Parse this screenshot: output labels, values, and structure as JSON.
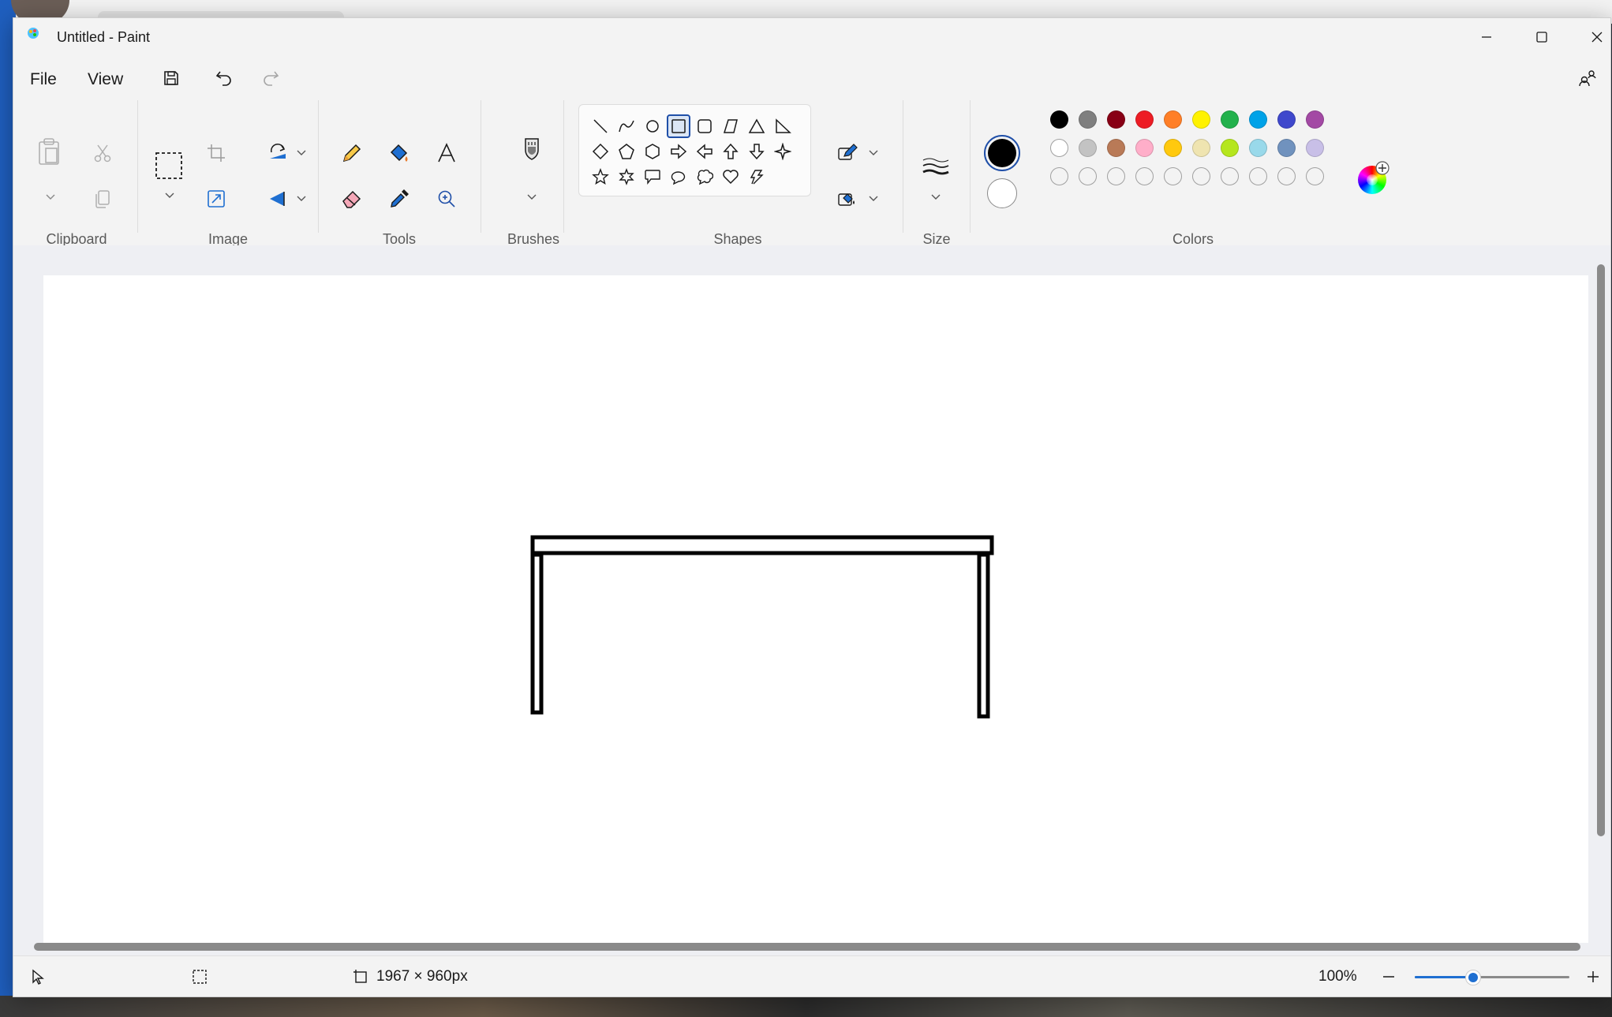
{
  "window": {
    "title": "Untitled - Paint"
  },
  "menu": {
    "file": "File",
    "view": "View"
  },
  "ribbon": {
    "groups": {
      "clipboard": "Clipboard",
      "image": "Image",
      "tools": "Tools",
      "brushes": "Brushes",
      "shapes": "Shapes",
      "size": "Size",
      "colors": "Colors"
    }
  },
  "colors": {
    "primary": "#000000",
    "secondary": "#ffffff",
    "palette_row1": [
      "#000000",
      "#7f7f7f",
      "#880015",
      "#ed1c24",
      "#ff7f27",
      "#fff200",
      "#22b14c",
      "#00a2e8",
      "#3f48cc",
      "#a349a4"
    ],
    "palette_row2": [
      "#ffffff",
      "#c3c3c3",
      "#b97a57",
      "#ffaec9",
      "#ffc90e",
      "#efe4b0",
      "#b5e61d",
      "#99d9ea",
      "#7092be",
      "#c8bfe7"
    ],
    "palette_row3": [
      "empty",
      "empty",
      "empty",
      "empty",
      "empty",
      "empty",
      "empty",
      "empty",
      "empty",
      "empty"
    ]
  },
  "status": {
    "canvas_size": "1967 × 960px",
    "zoom": "100%",
    "zoom_level": 0.38
  }
}
